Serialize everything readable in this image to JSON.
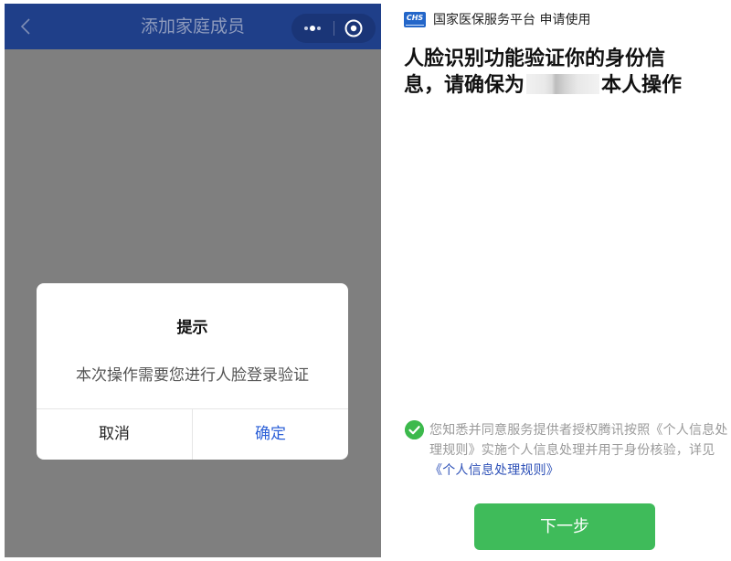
{
  "left_screen": {
    "nav": {
      "title": "添加家庭成员"
    },
    "dialog": {
      "title": "提示",
      "message": "本次操作需要您进行人脸登录验证",
      "cancel_label": "取消",
      "confirm_label": "确定"
    }
  },
  "right_screen": {
    "brand": {
      "logo_text": "CHS",
      "text": "国家医保服务平台 申请使用"
    },
    "headline": {
      "line1": "人脸识别功能验证你的身份信",
      "line2_prefix": "息，请确保为",
      "line2_suffix": "本人操作"
    },
    "consent": {
      "checked": true,
      "text": "您知悉并同意服务提供者授权腾讯按照《个人信息处理规则》实施个人信息处理并用于身份核验，详见 ",
      "link": "《个人信息处理规则》"
    },
    "next_button_label": "下一步"
  },
  "colors": {
    "nav_bg": "#1f3f89",
    "overlay_gray": "#7f7f7f",
    "confirm_blue": "#2b5fd7",
    "accent_green": "#3fbb5a",
    "link_blue": "#2f52b8"
  }
}
